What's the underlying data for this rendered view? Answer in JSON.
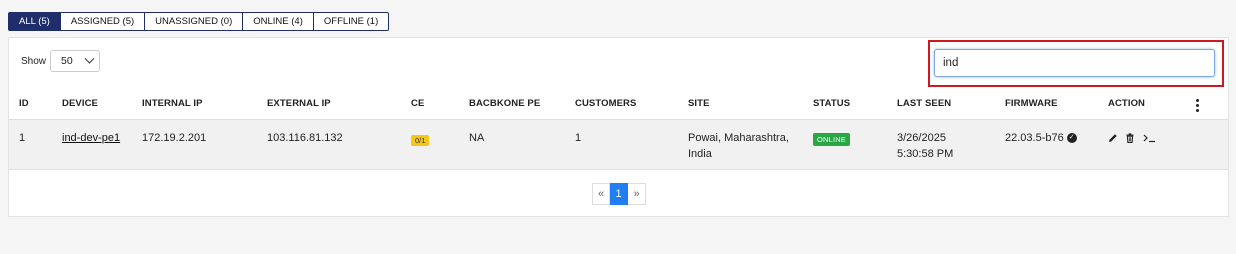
{
  "tabs": [
    {
      "label": "ALL (5)"
    },
    {
      "label": "ASSIGNED (5)"
    },
    {
      "label": "UNASSIGNED (0)"
    },
    {
      "label": "ONLINE (4)"
    },
    {
      "label": "OFFLINE (1)"
    }
  ],
  "active_tab": "ALL (5)",
  "show": {
    "label": "Show",
    "value": "50"
  },
  "search": {
    "value": "ind",
    "highlight_color": "#d0161f"
  },
  "columns": {
    "id": "ID",
    "device": "DEVICE",
    "internal_ip": "INTERNAL IP",
    "external_ip": "EXTERNAL IP",
    "ce": "CE",
    "backbone_pe": "BACBKONE PE",
    "customers": "CUSTOMERS",
    "site": "SITE",
    "status": "STATUS",
    "last_seen": "LAST SEEN",
    "firmware": "FIRMWARE",
    "action": "ACTION"
  },
  "rows": [
    {
      "id": "1",
      "device": "ind-dev-pe1",
      "internal_ip": "172.19.2.201",
      "external_ip": "103.116.81.132",
      "ce": "0/1",
      "backbone_pe": "NA",
      "customers": "1",
      "site": "Powai, Maharashtra, India",
      "status": "ONLINE",
      "last_seen": "3/26/2025 5:30:58 PM",
      "firmware": "22.03.5-b76",
      "firmware_icon": "check-circle-icon",
      "actions": [
        "edit-icon",
        "trash-icon",
        "terminal-icon"
      ]
    }
  ],
  "pagination": {
    "prev": "«",
    "current": "1",
    "next": "»"
  },
  "colors": {
    "tab_active": "#1f2d6b",
    "status_online": "#27a844",
    "ce_badge": "#f5c518",
    "page_current": "#1e7ef2"
  }
}
